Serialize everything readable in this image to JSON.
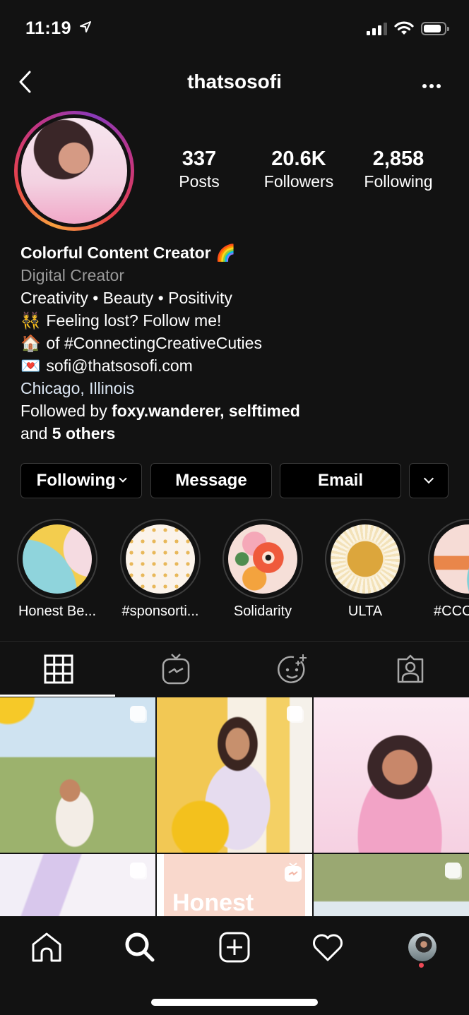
{
  "status_bar": {
    "time": "11:19",
    "location_icon": "location-arrow-icon",
    "signal_icon": "cellular-signal-icon",
    "wifi_icon": "wifi-icon",
    "battery_icon": "battery-icon"
  },
  "header": {
    "username": "thatsosofi",
    "back_icon": "chevron-left-icon",
    "more_icon": "more-horizontal-icon"
  },
  "stats": [
    {
      "value": "337",
      "label": "Posts"
    },
    {
      "value": "20.6K",
      "label": "Followers"
    },
    {
      "value": "2,858",
      "label": "Following"
    }
  ],
  "bio": {
    "name": "Colorful Content Creator",
    "name_emoji": "🌈",
    "category": "Digital Creator",
    "line1": "Creativity • Beauty • Positivity",
    "line2_emoji": "👯",
    "line2": "Feeling lost? Follow me!",
    "line3_emoji": "🏠",
    "line3": "of #ConnectingCreativeCuties",
    "line4_emoji": "💌",
    "line4": "sofi@thatsosofi.com",
    "location": "Chicago, Illinois",
    "followed_by_prefix": "Followed by ",
    "followed_by_users": "foxy.wanderer, selftimed",
    "followed_by_and": "and ",
    "followed_by_others": "5 others"
  },
  "actions": {
    "following": "Following",
    "message": "Message",
    "email": "Email"
  },
  "highlights": [
    {
      "label": "Honest Be..."
    },
    {
      "label": "#sponsorti..."
    },
    {
      "label": "Solidarity"
    },
    {
      "label": "ULTA"
    },
    {
      "label": "#CCC"
    }
  ],
  "tabs": [
    {
      "name": "posts-grid",
      "icon": "grid-icon",
      "active": true
    },
    {
      "name": "igtv",
      "icon": "igtv-icon",
      "active": false
    },
    {
      "name": "effects",
      "icon": "face-sparkle-icon",
      "active": false
    },
    {
      "name": "tagged",
      "icon": "tagged-person-icon",
      "active": false
    }
  ],
  "grid_tile_text": "Honest",
  "bottom_nav": [
    "home-icon",
    "search-icon",
    "new-post-icon",
    "activity-heart-icon",
    "profile-avatar"
  ]
}
